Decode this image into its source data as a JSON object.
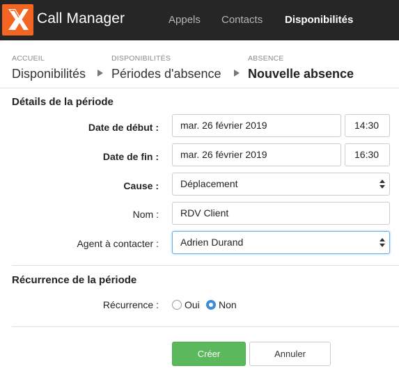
{
  "app": {
    "title": "Call Manager",
    "logo_icon": "x-logo-icon",
    "brand_color": "#f26522"
  },
  "nav": {
    "items": [
      {
        "label": "Appels",
        "active": false
      },
      {
        "label": "Contacts",
        "active": false
      },
      {
        "label": "Disponibilités",
        "active": true
      }
    ]
  },
  "breadcrumb": {
    "items": [
      {
        "small": "ACCUEIL",
        "label": "Disponibilités"
      },
      {
        "small": "DISPONIBILITÉS",
        "label": "Périodes d'absence"
      },
      {
        "small": "ABSENCE",
        "label": "Nouvelle absence"
      }
    ]
  },
  "details": {
    "title": "Détails de la période",
    "start_label": "Date de début :",
    "start_date": "mar. 26 février 2019",
    "start_time": "14:30",
    "end_label": "Date de fin :",
    "end_date": "mar. 26 février 2019",
    "end_time": "16:30",
    "cause_label": "Cause :",
    "cause_value": "Déplacement",
    "name_label": "Nom :",
    "name_value": "RDV Client",
    "agent_label": "Agent à contacter :",
    "agent_value": "Adrien Durand"
  },
  "recurrence": {
    "title": "Récurrence de la période",
    "label": "Récurrence :",
    "option_yes": "Oui",
    "option_no": "Non",
    "selected": "Non"
  },
  "actions": {
    "create_label": "Créer",
    "cancel_label": "Annuler",
    "primary_color": "#5cb85c"
  }
}
